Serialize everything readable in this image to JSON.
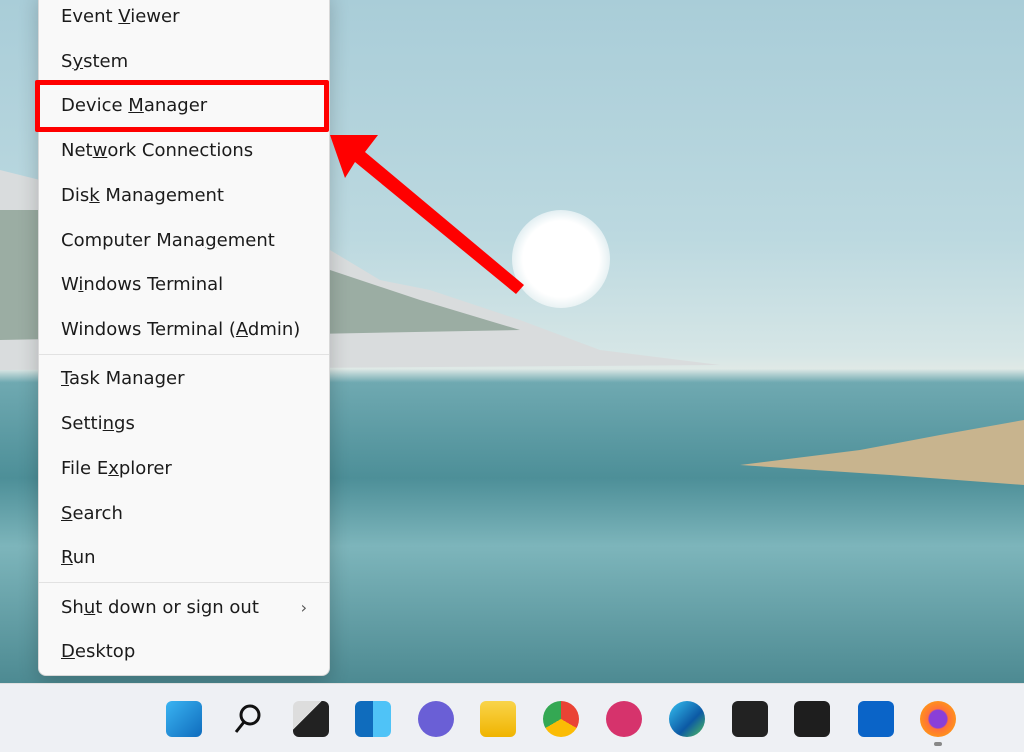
{
  "menu": {
    "items": [
      {
        "parts": [
          "Event ",
          "V",
          "iewer"
        ]
      },
      {
        "parts": [
          "S",
          "y",
          "stem"
        ]
      },
      {
        "parts": [
          "Device ",
          "M",
          "anager"
        ]
      },
      {
        "parts": [
          "Net",
          "w",
          "ork Connections"
        ]
      },
      {
        "parts": [
          "Dis",
          "k",
          " Management"
        ]
      },
      {
        "parts": [
          "Computer Mana",
          "g",
          "ement"
        ]
      },
      {
        "parts": [
          "W",
          "i",
          "ndows Terminal"
        ]
      },
      {
        "parts": [
          "Windows Terminal (",
          "A",
          "dmin)"
        ]
      },
      {
        "parts": [
          "",
          "T",
          "ask Manager"
        ]
      },
      {
        "parts": [
          "Setti",
          "n",
          "gs"
        ]
      },
      {
        "parts": [
          "File E",
          "x",
          "plorer"
        ]
      },
      {
        "parts": [
          "",
          "S",
          "earch"
        ]
      },
      {
        "parts": [
          "",
          "R",
          "un"
        ]
      },
      {
        "parts": [
          "Sh",
          "u",
          "t down or sign out"
        ]
      },
      {
        "parts": [
          "",
          "D",
          "esktop"
        ]
      }
    ],
    "submenu_chevron": "›",
    "highlighted": "Device Manager"
  },
  "annotation": {
    "color": "#ff0000"
  },
  "taskbar": {
    "icons": [
      "start-icon",
      "search-icon",
      "task-view-icon",
      "widgets-icon",
      "chat-icon",
      "file-explorer-icon",
      "chrome-icon",
      "skitch-icon",
      "edge-icon",
      "screen-recorder-icon",
      "figma-icon",
      "outlook-icon",
      "firefox-icon"
    ]
  }
}
